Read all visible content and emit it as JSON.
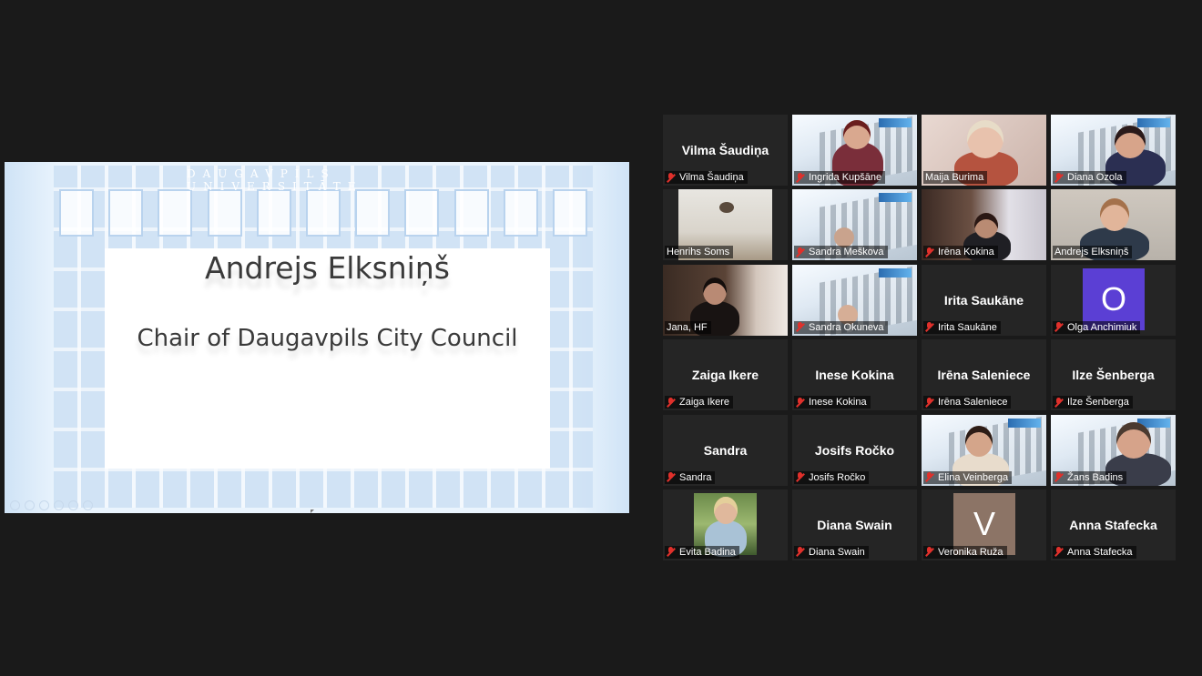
{
  "share": {
    "building_caption": "DAUGAVPILS UNIVERSITĀTE",
    "slide_name": "Andrejs Elksniņš",
    "slide_role": "Chair of Daugavpils City Council"
  },
  "colors": {
    "active_speaker_border": "#c7f14a",
    "muted_mic": "#e0302b",
    "tile_bg": "#252525",
    "page_bg": "#1a1a1a",
    "avatar_olga": "#5b3fd4",
    "avatar_veronika": "#8c7466"
  },
  "tiles": [
    {
      "display": "Vilma Šaudiņa",
      "label": "Vilma Šaudiņa"
    },
    {
      "label": "Ingrida Kupšāne"
    },
    {
      "label": "Maija Burima"
    },
    {
      "label": "Diana Ozola"
    },
    {
      "label": "Henrihs Soms"
    },
    {
      "label": "Sandra Meškova"
    },
    {
      "label": "Irēna Kokina"
    },
    {
      "label": "Andrejs Elksniņš"
    },
    {
      "label": "Jana, HF"
    },
    {
      "label": "Sandra Okuneva"
    },
    {
      "display": "Irita Saukāne",
      "label": "Irita Saukāne"
    },
    {
      "avatar": "O",
      "label": "Olga Anchimiuk"
    },
    {
      "display": "Zaiga Ikere",
      "label": "Zaiga Ikere"
    },
    {
      "display": "Inese Kokina",
      "label": "Inese Kokina"
    },
    {
      "display": "Irēna Saleniece",
      "label": "Irēna Saleniece"
    },
    {
      "display": "Ilze Šenberga",
      "label": "Ilze Šenberga"
    },
    {
      "display": "Sandra",
      "label": "Sandra"
    },
    {
      "display": "Josifs Ročko",
      "label": "Josifs Ročko"
    },
    {
      "label": "Elina Veinberga"
    },
    {
      "label": "Žans Badins"
    },
    {
      "label": "Evita Badina"
    },
    {
      "display": "Diana Swain",
      "label": "Diana Swain"
    },
    {
      "avatar": "V",
      "label": "Veronika Ruža"
    },
    {
      "display": "Anna Stafecka",
      "label": "Anna Stafecka"
    }
  ]
}
